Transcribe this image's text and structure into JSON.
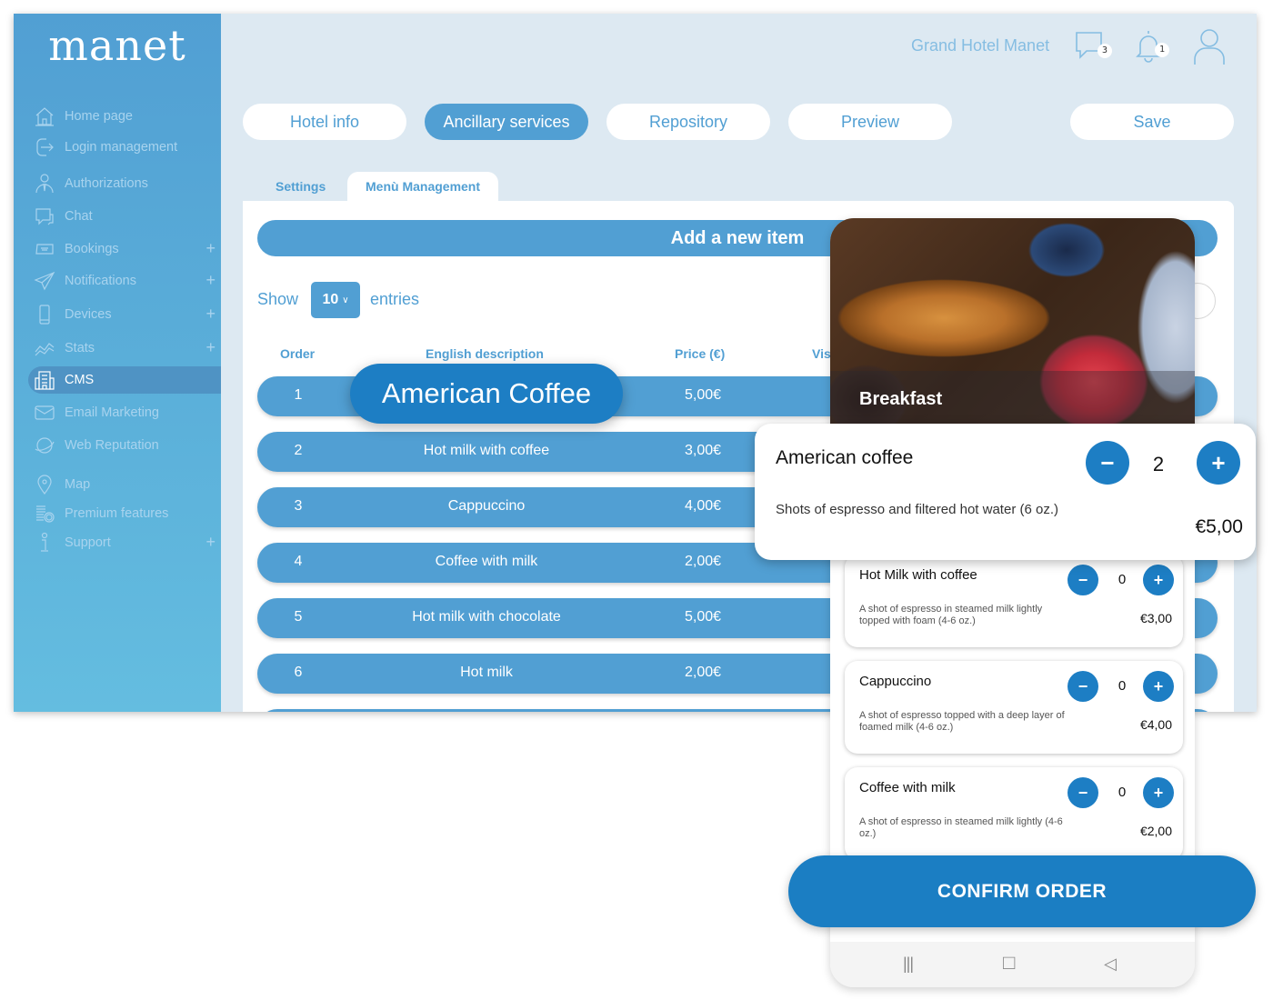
{
  "sidebar": {
    "logo": "manet",
    "items": [
      {
        "label": "Home page",
        "icon": "home-icon",
        "expandable": false
      },
      {
        "label": "Login management",
        "icon": "login-icon",
        "expandable": false
      },
      {
        "label": "Authorizations",
        "icon": "user-tie-icon",
        "expandable": false
      },
      {
        "label": "Chat",
        "icon": "chat-icon",
        "expandable": false
      },
      {
        "label": "Bookings",
        "icon": "booking-icon",
        "expandable": true
      },
      {
        "label": "Notifications",
        "icon": "paper-plane-icon",
        "expandable": true
      },
      {
        "label": "Devices",
        "icon": "smartphone-icon",
        "expandable": true
      },
      {
        "label": "Stats",
        "icon": "stats-icon",
        "expandable": true
      },
      {
        "label": "CMS",
        "icon": "building-icon",
        "expandable": false,
        "active": true
      },
      {
        "label": "Email Marketing",
        "icon": "envelope-icon",
        "expandable": false
      },
      {
        "label": "Web Reputation",
        "icon": "planet-icon",
        "expandable": false
      },
      {
        "label": "Map",
        "icon": "map-pin-icon",
        "expandable": false
      },
      {
        "label": "Premium features",
        "icon": "coins-icon",
        "expandable": false
      },
      {
        "label": "Support",
        "icon": "info-icon",
        "expandable": true
      }
    ],
    "expand_symbol": "+"
  },
  "header": {
    "hotel_name": "Grand Hotel Manet",
    "chat_badge": "3",
    "notification_badge": "1"
  },
  "top_tabs": [
    {
      "label": "Hotel info",
      "active": false
    },
    {
      "label": "Ancillary services",
      "active": true
    },
    {
      "label": "Repository",
      "active": false
    },
    {
      "label": "Preview",
      "active": false
    }
  ],
  "save_label": "Save",
  "sub_tabs": [
    {
      "label": "Settings",
      "active": false
    },
    {
      "label": "Menù Management",
      "active": true
    }
  ],
  "panel": {
    "add_item_label": "Add a new item",
    "show_label": "Show",
    "entries_value": "10",
    "entries_label": "entries",
    "columns": [
      "Order",
      "English description",
      "Price (€)",
      "Vis"
    ],
    "rows": [
      {
        "order": "1",
        "description": "American Coffee",
        "price": "5,00€"
      },
      {
        "order": "2",
        "description": "Hot milk with coffee",
        "price": "3,00€"
      },
      {
        "order": "3",
        "description": "Cappuccino",
        "price": "4,00€"
      },
      {
        "order": "4",
        "description": "Coffee with milk",
        "price": "2,00€"
      },
      {
        "order": "5",
        "description": "Hot milk with chocolate",
        "price": "5,00€"
      },
      {
        "order": "6",
        "description": "Hot milk",
        "price": "2,00€"
      }
    ]
  },
  "floating_pill": "American Coffee",
  "phone": {
    "category_title": "Breakfast",
    "selected_item": {
      "name": "American coffee",
      "description": "Shots of espresso and filtered hot water (6 oz.)",
      "price": "€5,00",
      "quantity": "2"
    },
    "items": [
      {
        "name": "Hot Milk with coffee",
        "description": "A shot of espresso in steamed milk lightly topped with foam (4-6 oz.)",
        "price": "€3,00",
        "quantity": "0"
      },
      {
        "name": "Cappuccino",
        "description": "A shot of espresso topped with a deep layer of foamed milk (4-6 oz.)",
        "price": "€4,00",
        "quantity": "0"
      },
      {
        "name": "Coffee with milk",
        "description": "A shot of espresso in steamed milk lightly (4-6 oz.)",
        "price": "€2,00",
        "quantity": "0"
      }
    ],
    "minus": "−",
    "plus": "+",
    "confirm_label": "CONFIRM ORDER",
    "nav": {
      "recents": "|||",
      "home": "□",
      "back": "◁"
    }
  },
  "colors": {
    "primary": "#519fd3",
    "accent": "#1d7ec4",
    "background": "#dde9f2"
  }
}
